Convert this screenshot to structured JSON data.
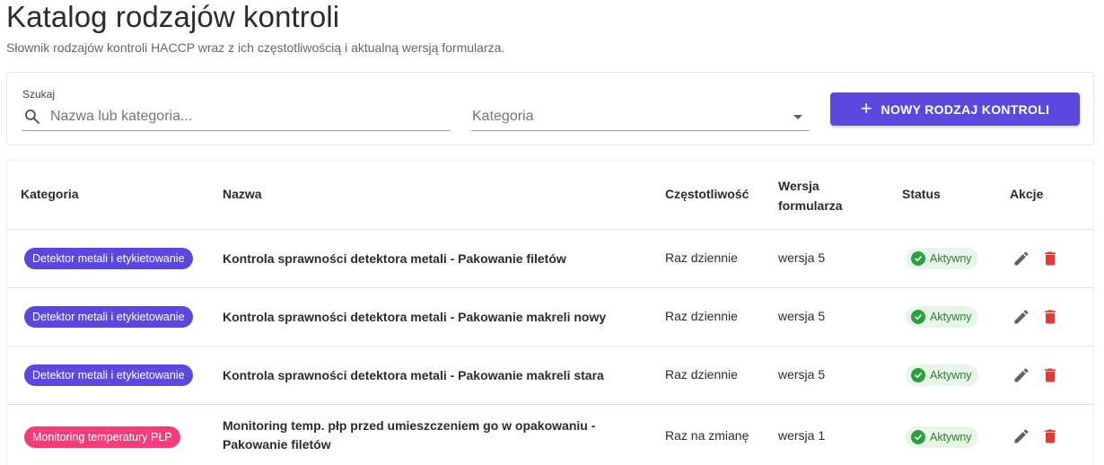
{
  "page": {
    "title": "Katalog rodzajów kontroli",
    "subtitle": "Słownik rodzajów kontroli HACCP wraz z ich częstotliwością i aktualną wersją formularza."
  },
  "filters": {
    "search_label": "Szukaj",
    "search_placeholder": "Nazwa lub kategoria...",
    "search_value": "",
    "category_label": "Kategoria",
    "new_button_label": "NOWY RODZAJ KONTROLI",
    "icons": {
      "search": "search-icon",
      "dropdown": "chevron-down-icon",
      "add": "plus-icon"
    }
  },
  "table": {
    "headers": {
      "category": "Kategoria",
      "name": "Nazwa",
      "frequency": "Częstotliwość",
      "version_line1": "Wersja",
      "version_line2": "formularza",
      "status": "Status",
      "actions": "Akcje"
    },
    "rows": [
      {
        "category": "Detektor metali i etykietowanie",
        "category_color": "#5b49de",
        "name": "Kontrola sprawności detektora metali - Pakowanie filetów",
        "frequency": "Raz dziennie",
        "version": "wersja 5",
        "status": "Aktywny"
      },
      {
        "category": "Detektor metali i etykietowanie",
        "category_color": "#5b49de",
        "name": "Kontrola sprawności detektora metali - Pakowanie makreli nowy",
        "frequency": "Raz dziennie",
        "version": "wersja 5",
        "status": "Aktywny"
      },
      {
        "category": "Detektor metali i etykietowanie",
        "category_color": "#5b49de",
        "name": "Kontrola sprawności detektora metali - Pakowanie makreli stara",
        "frequency": "Raz dziennie",
        "version": "wersja 5",
        "status": "Aktywny"
      },
      {
        "category": "Monitoring temperatury PŁP",
        "category_color": "#f23d7b",
        "name": "Monitoring temp. płp przed umieszczeniem go w opakowaniu - Pakowanie filetów",
        "frequency": "Raz na zmianę",
        "version": "wersja 1",
        "status": "Aktywny"
      }
    ],
    "action_icons": [
      "edit-icon",
      "delete-icon"
    ],
    "colors": {
      "accent": "#5b49de",
      "active_status": "#2e9e43",
      "delete": "#e53935"
    }
  }
}
